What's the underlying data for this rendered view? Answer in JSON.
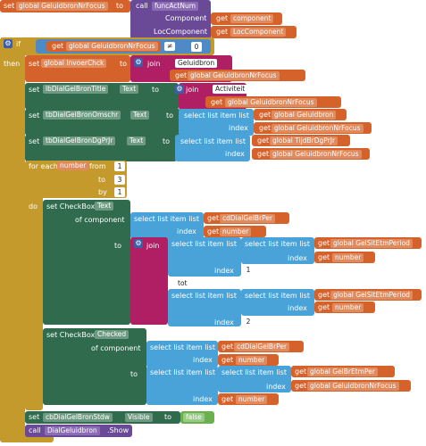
{
  "top_set": {
    "set": "set",
    "var": "global GeluidbronNrFocus",
    "to": "to",
    "call": "call",
    "proc": "funcActNum",
    "component_label": "Component",
    "get": "get",
    "component_var": "component",
    "loccomponent_label": "LocComponent",
    "loccomponent_var": "LocComponent"
  },
  "if_block": {
    "if": "if",
    "then": "then",
    "get": "get",
    "var": "global GeluidbronNrFocus",
    "op": "≠",
    "value": "0"
  },
  "invoer": {
    "set": "set",
    "var": "global InvoerChck",
    "to": "to",
    "join": "join",
    "str": "Geluidbron",
    "get": "get",
    "var2": "global GeluidbronNrFocus"
  },
  "titel": {
    "set": "set",
    "comp": "lbDialGelBronTitle",
    "prop": "Text",
    "to": "to",
    "join": "join",
    "str": "Activiteit",
    "get": "get",
    "var": "global GeluidbronNrFocus"
  },
  "omschr": {
    "set": "set",
    "comp": "tbDialGelBronOmschr",
    "prop": "Text",
    "to": "to",
    "select": "select list item  list",
    "list_var": "global Geluidbron",
    "index": "index",
    "get": "get",
    "index_var": "global GeluidbronNrFocus"
  },
  "dgprjr": {
    "set": "set",
    "comp": "tbDialGelBronDgPrJr",
    "prop": "Text",
    "to": "to",
    "select": "select list item  list",
    "list_var": "global TijdBrDgPrJr",
    "index": "index",
    "get": "get",
    "index_var": "global GeluidbronNrFocus"
  },
  "for_each": {
    "label": "for each",
    "var": "number",
    "from": "from",
    "from_val": "1",
    "to": "to",
    "to_val": "3",
    "by": "by",
    "by_val": "1",
    "do": "do"
  },
  "checkbox_text": {
    "set": "set CheckBox.",
    "prop": "Text",
    "of_component": "of component",
    "select": "select list item  list",
    "get": "get",
    "list_var": "cdDialGelBrPer",
    "index": "index",
    "index_var": "number",
    "to": "to",
    "join": "join",
    "tot": "tot",
    "inner_list": "global GelSitEtmPeriod",
    "num1": "1",
    "num2": "2"
  },
  "checkbox_checked": {
    "set": "set CheckBox.",
    "prop": "Checked",
    "of_component": "of component",
    "select": "select list item  list",
    "get": "get",
    "list_var": "cdDialGelBrPer",
    "index": "index",
    "index_var": "number",
    "to": "to",
    "inner_list": "global GelBrEtmPer",
    "inner_index": "global GeluidbronNrFocus"
  },
  "stdw": {
    "set": "set",
    "comp": "cbDialGelBronStdw",
    "prop": "Visible",
    "to": "to",
    "value": "false"
  },
  "show": {
    "call": "call",
    "comp": "DialGeluidbron",
    "method": ".Show"
  }
}
